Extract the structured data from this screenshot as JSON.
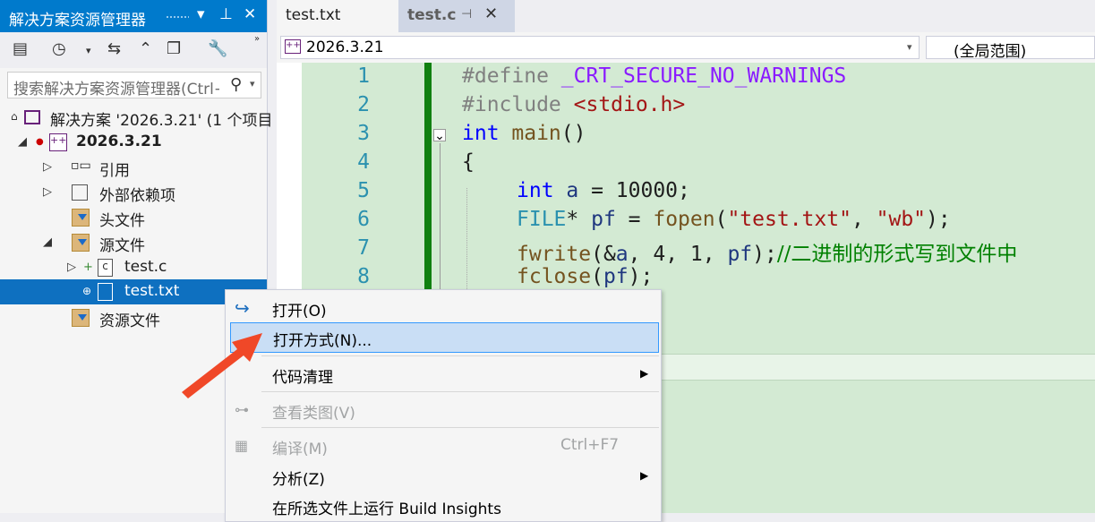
{
  "colors": {
    "accent": "#007acc",
    "selection": "#0e70c0",
    "menu_hover": "#c9def5",
    "changebar": "#108010",
    "arrow": "#f04828"
  },
  "solution_explorer": {
    "title": "解决方案资源管理器",
    "search_placeholder": "搜索解决方案资源管理器(Ctrl+;)",
    "tree": {
      "solution": "解决方案 '2026.3.21' (1 个项目",
      "project": "2026.3.21",
      "references": "引用",
      "external_deps": "外部依赖项",
      "header_files": "头文件",
      "source_files": "源文件",
      "test_c": "test.c",
      "test_txt": "test.txt",
      "resource_files": "资源文件"
    }
  },
  "editor": {
    "tabs": [
      {
        "label": "test.txt"
      },
      {
        "label": "test.c"
      }
    ],
    "nav": {
      "project": "2026.3.21",
      "scope": "(全局范围)"
    },
    "line_numbers": [
      "1",
      "2",
      "3",
      "4",
      "5",
      "6",
      "7",
      "8"
    ],
    "code": {
      "l1_pp": "#define ",
      "l1_mac": "_CRT_SECURE_NO_WARNINGS",
      "l2_pp": "#include ",
      "l2_str": "<stdio.h>",
      "l3_kw": "int",
      "l3_fn": " main",
      "l3_rest": "()",
      "l4": "{",
      "l5_kw": "int",
      "l5_id": " a",
      "l5_rest": " = 10000;",
      "l6_ty": "FILE",
      "l6_a": "* ",
      "l6_id": "pf",
      "l6_b": " = ",
      "l6_fn": "fopen",
      "l6_c": "(",
      "l6_s1": "\"test.txt\"",
      "l6_d": ", ",
      "l6_s2": "\"wb\"",
      "l6_e": ");",
      "l7_fn": "fwrite",
      "l7_a": "(&",
      "l7_id1": "a",
      "l7_b": ", 4, 1, ",
      "l7_id2": "pf",
      "l7_c": ");",
      "l7_cm": "//二进制的形式写到文件中",
      "l8_fn": "fclose",
      "l8_a": "(",
      "l8_id": "pf",
      "l8_b": ");"
    }
  },
  "context_menu": {
    "open": "打开(O)",
    "open_with": "打开方式(N)...",
    "code_cleanup": "代码清理",
    "view_class_diagram": "查看类图(V)",
    "compile": "编译(M)",
    "compile_shortcut": "Ctrl+F7",
    "analyze": "分析(Z)",
    "build_insights": "在所选文件上运行 Build Insights"
  }
}
